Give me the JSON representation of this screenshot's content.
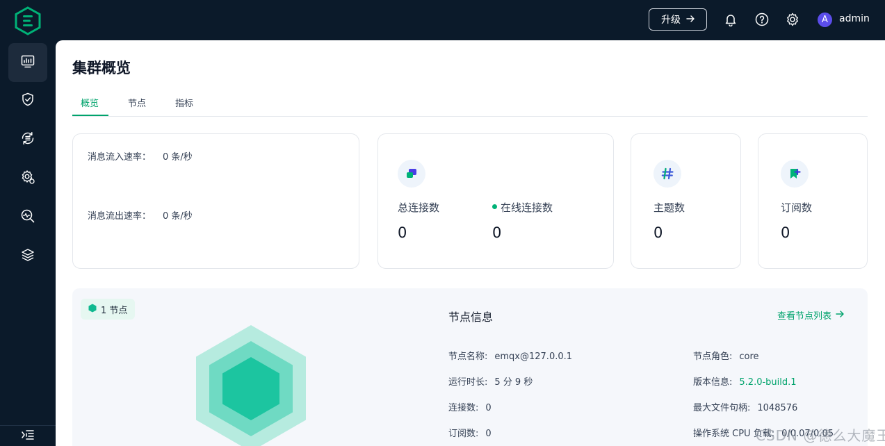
{
  "header": {
    "upgrade_label": "升级",
    "user_initial": "A",
    "username": "admin"
  },
  "sidebar": {
    "items": [
      {
        "name": "dashboard",
        "icon": "monitor-chart-icon",
        "active": true
      },
      {
        "name": "access-control",
        "icon": "shield-check-icon"
      },
      {
        "name": "integration",
        "icon": "refresh-list-icon"
      },
      {
        "name": "management",
        "icon": "gear-icon"
      },
      {
        "name": "diagnose",
        "icon": "search-pulse-icon"
      },
      {
        "name": "system",
        "icon": "layers-icon"
      }
    ]
  },
  "page": {
    "title": "集群概览",
    "tabs": [
      {
        "label": "概览",
        "active": true
      },
      {
        "label": "节点"
      },
      {
        "label": "指标"
      }
    ]
  },
  "rates": {
    "in_label": "消息流入速率：",
    "in_value": "0 条/秒",
    "out_label": "消息流出速率：",
    "out_value": "0 条/秒"
  },
  "stats": {
    "total_connections_label": "总连接数",
    "total_connections_value": "0",
    "online_connections_label": "在线连接数",
    "online_connections_value": "0",
    "topics_label": "主题数",
    "topics_value": "0",
    "subscriptions_label": "订阅数",
    "subscriptions_value": "0"
  },
  "nodes": {
    "badge": "1 节点",
    "info_title": "节点信息",
    "list_link": "查看节点列表",
    "rows": {
      "name_label": "节点名称:",
      "name_value": "emqx@127.0.0.1",
      "uptime_label": "运行时长:",
      "uptime_value": "5 分 9 秒",
      "connections_label": "连接数:",
      "connections_value": "0",
      "subscriptions_label": "订阅数:",
      "subscriptions_value": "0",
      "role_label": "节点角色:",
      "role_value": "core",
      "version_label": "版本信息:",
      "version_value": "5.2.0-build.1",
      "max_fd_label": "最大文件句柄:",
      "max_fd_value": "1048576",
      "os_cpu_label": "操作系统 CPU 负载:",
      "os_cpu_value": "0/0.07/0.05"
    }
  },
  "watermark": "CSDN @德么大魔王",
  "colors": {
    "accent": "#00a36c",
    "dark_bg": "#0b1a2a",
    "avatar": "#5b4dea"
  }
}
